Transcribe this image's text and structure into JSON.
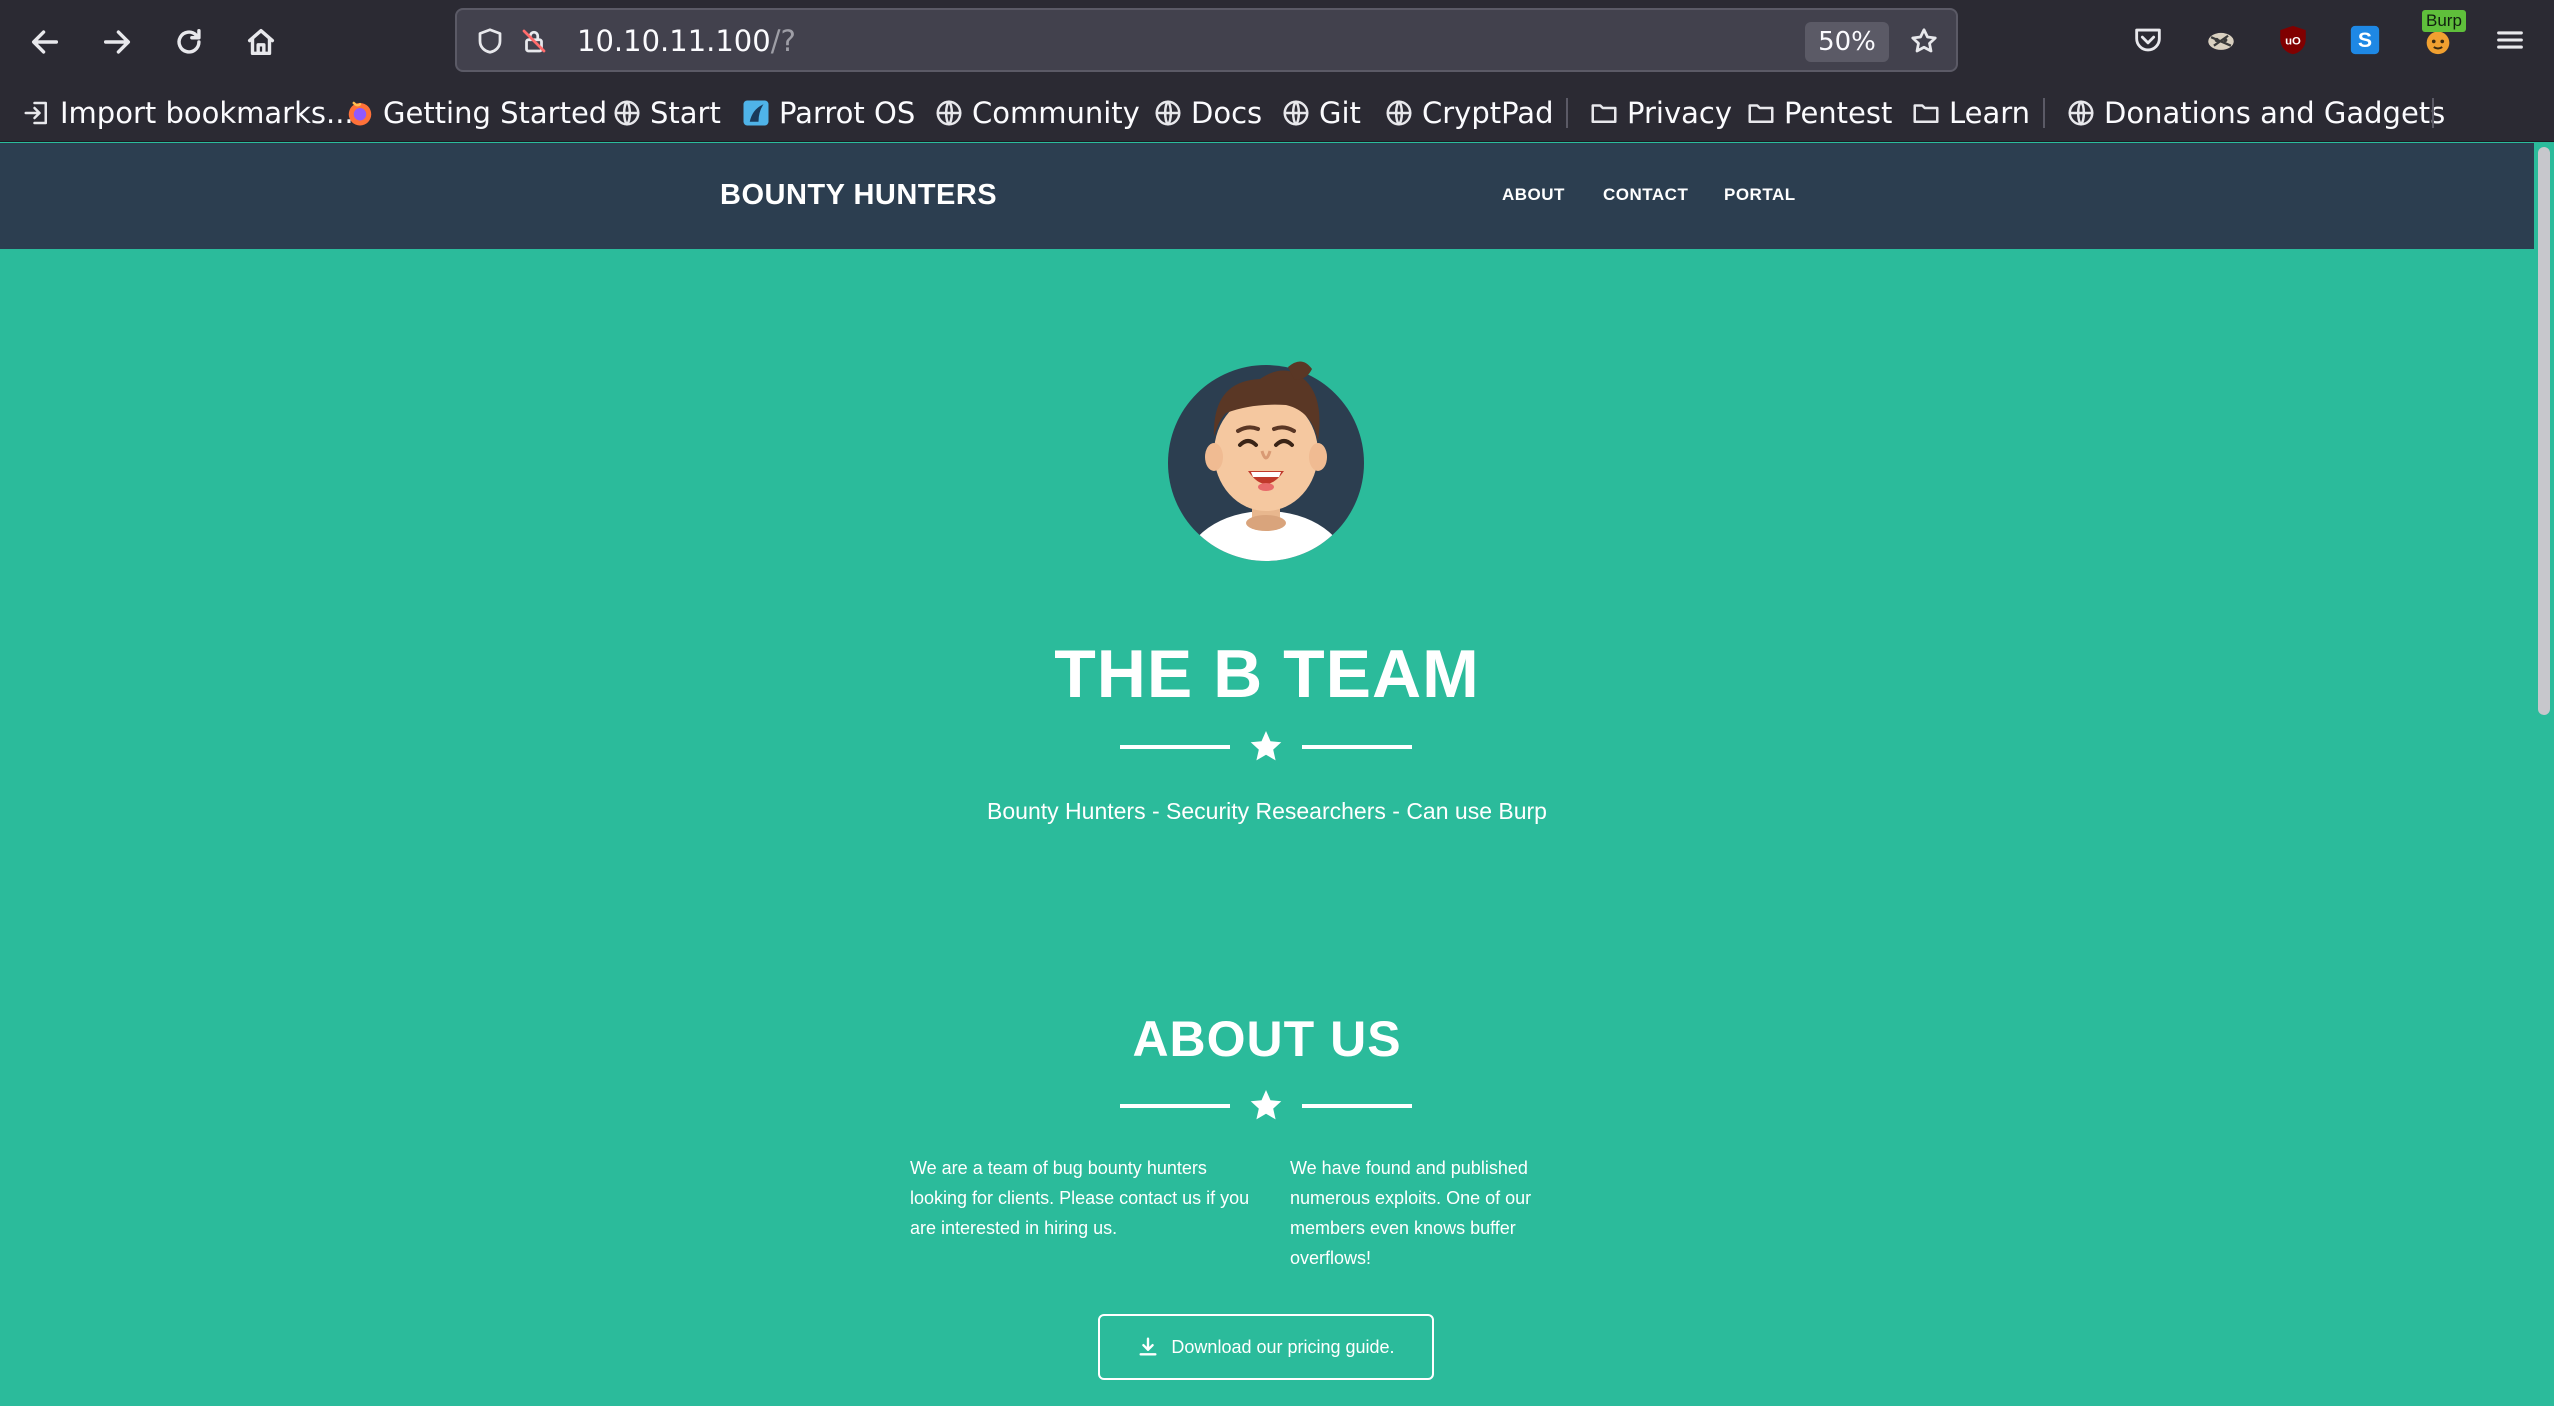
{
  "browser": {
    "url": {
      "host": "10.10.11.100",
      "path": "/?"
    },
    "zoom": "50%",
    "toolbar_icons": [
      "back-icon",
      "forward-icon",
      "reload-icon",
      "home-icon"
    ],
    "extensions": [
      "pocket-icon",
      "extension-icon",
      "ublock-icon",
      "s-extension-icon",
      "burp-icon",
      "menu-icon"
    ],
    "burp_badge": "Burp",
    "bookmarks": [
      {
        "label": "Import bookmarks...",
        "icon": "import-icon"
      },
      {
        "label": "Getting Started",
        "icon": "firefox-icon"
      },
      {
        "label": "Start",
        "icon": "globe-icon"
      },
      {
        "label": "Parrot OS",
        "icon": "parrot-icon"
      },
      {
        "label": "Community",
        "icon": "globe-icon"
      },
      {
        "label": "Docs",
        "icon": "globe-icon"
      },
      {
        "label": "Git",
        "icon": "globe-icon"
      },
      {
        "label": "CryptPad",
        "icon": "globe-icon"
      },
      {
        "label": "Privacy",
        "icon": "folder-icon"
      },
      {
        "label": "Pentest",
        "icon": "folder-icon"
      },
      {
        "label": "Learn",
        "icon": "folder-icon"
      },
      {
        "label": "Donations and Gadgets",
        "icon": "globe-icon"
      }
    ]
  },
  "site": {
    "brand": "BOUNTY HUNTERS",
    "nav": [
      "ABOUT",
      "CONTACT",
      "PORTAL"
    ],
    "hero": {
      "title": "THE B TEAM",
      "subtitle": "Bounty Hunters - Security Researchers - Can use Burp"
    },
    "about": {
      "title": "ABOUT US",
      "col1": "We are a team of bug bounty hunters looking for clients. Please contact us if you are interested in hiring us.",
      "col2": "We have found and published numerous exploits. One of our members even knows buffer overflows!"
    },
    "download_button": "Download our pricing guide."
  },
  "colors": {
    "page_bg": "#2bbb9b",
    "navbar_bg": "#2c3e50",
    "chrome_bg": "#2b2a33"
  }
}
